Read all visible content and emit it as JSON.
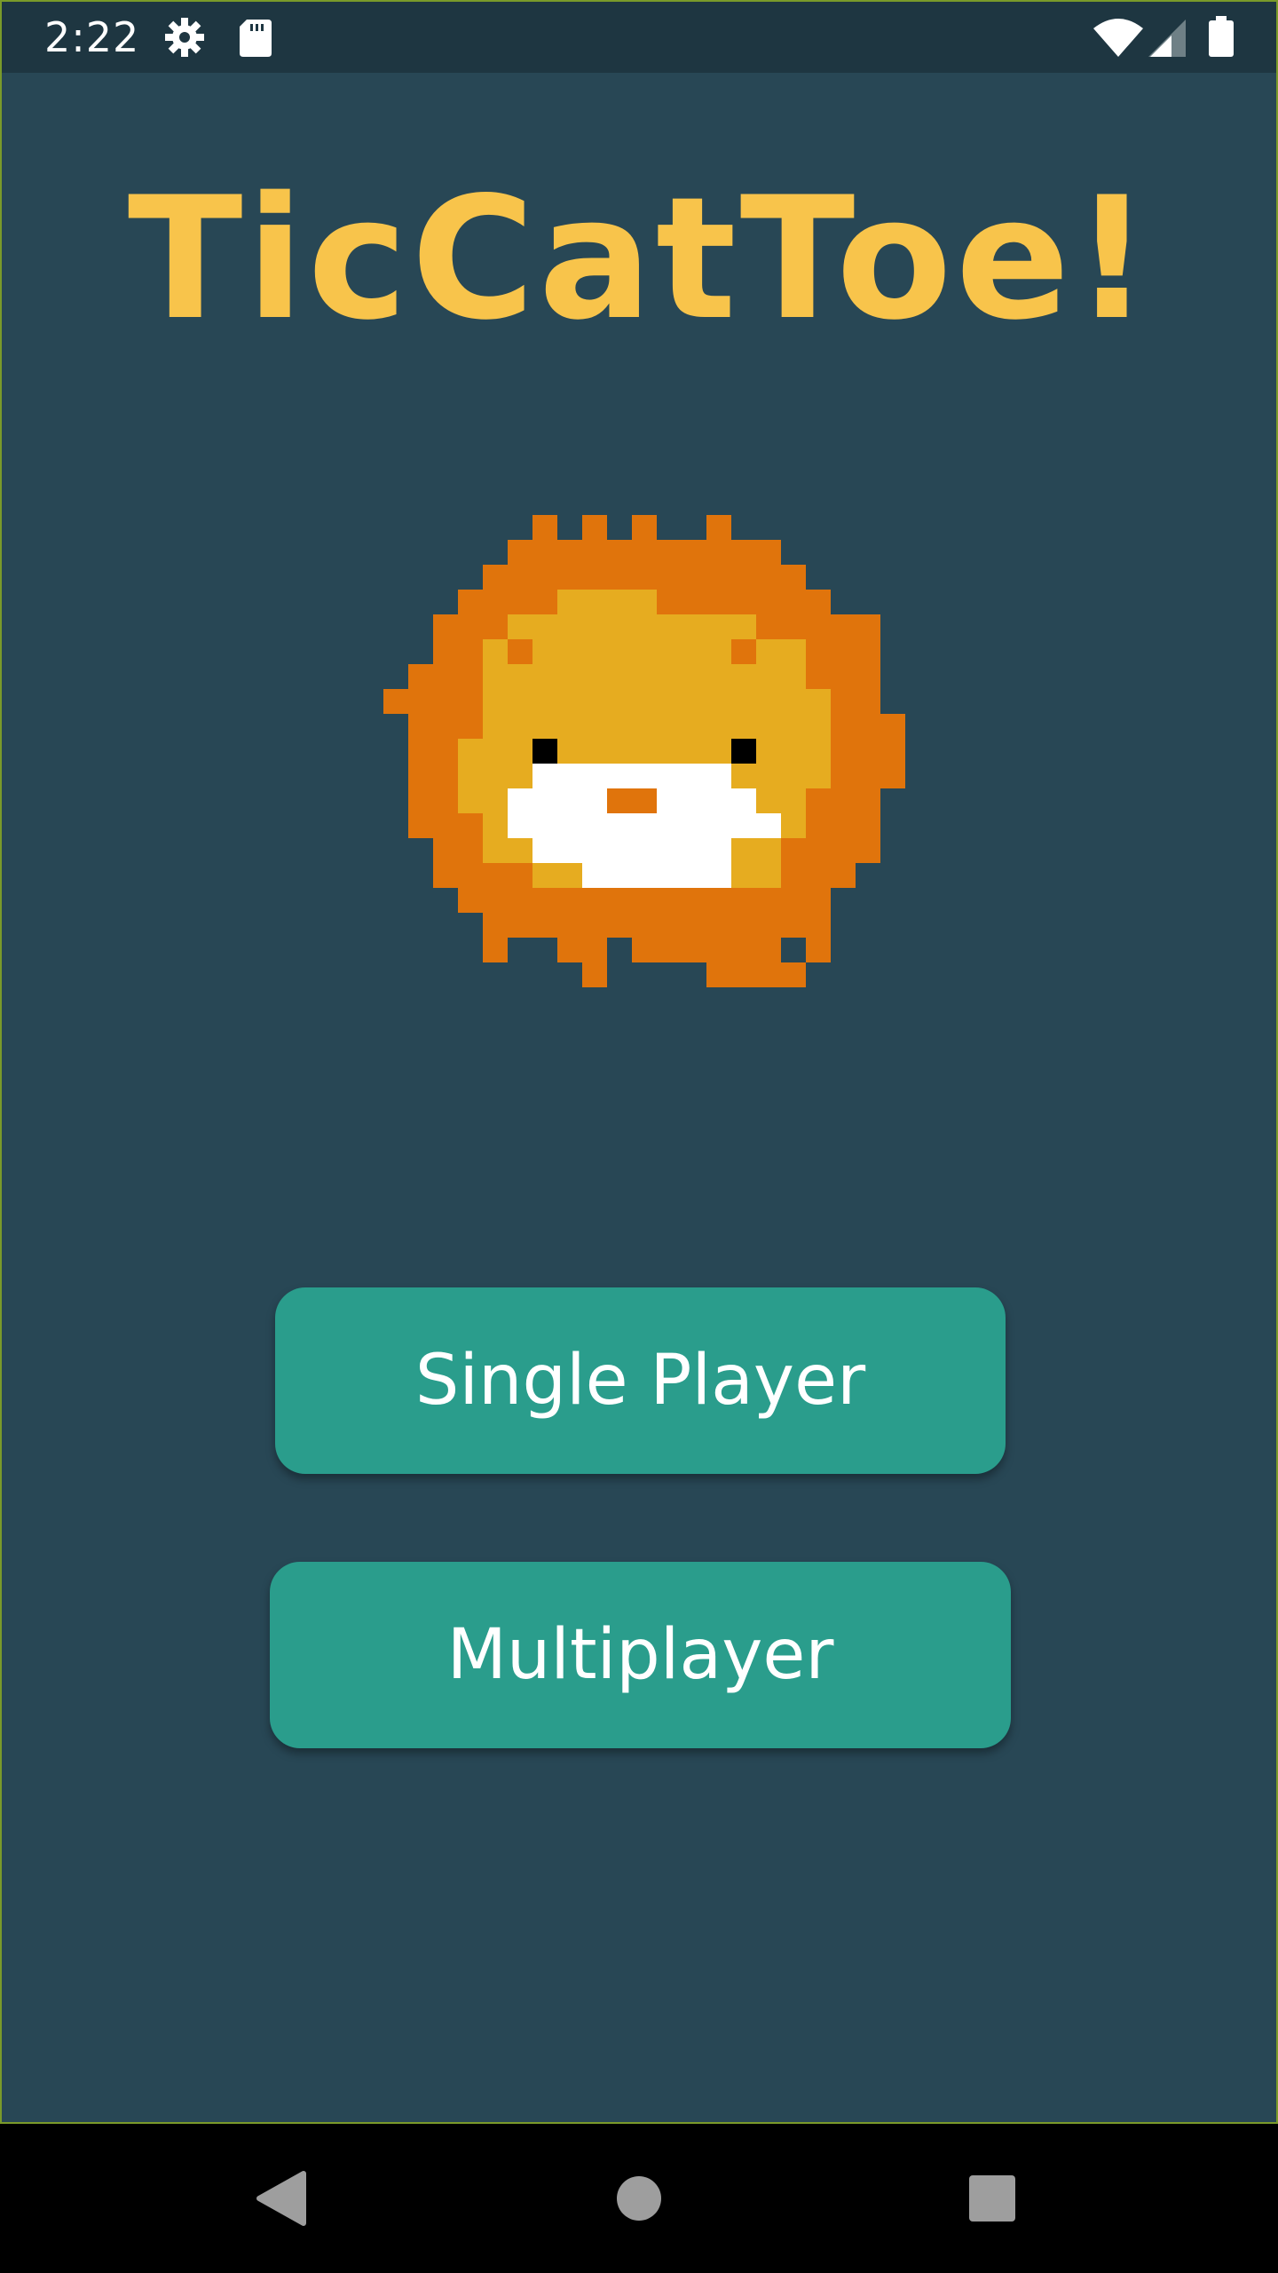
{
  "status_bar": {
    "time": "2:22",
    "icons": [
      "gear-icon",
      "sd-card-icon",
      "wifi-icon",
      "signal-icon",
      "battery-icon"
    ]
  },
  "app": {
    "title": "TicCatToe!",
    "title_color": "#f8c44b",
    "background_color": "#284755",
    "mascot": "pixel-lion-cat"
  },
  "menu": {
    "single_player_label": "Single Player",
    "multiplayer_label": "Multiplayer",
    "button_color": "#2a9d8c"
  },
  "nav_bar": {
    "buttons": [
      "back-icon",
      "home-icon",
      "recent-apps-icon"
    ]
  }
}
